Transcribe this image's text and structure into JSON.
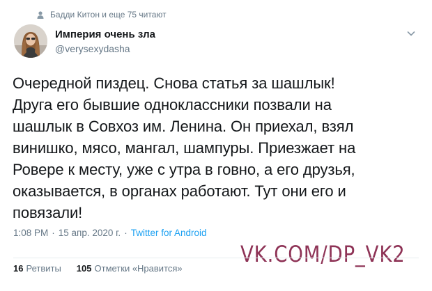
{
  "context": {
    "icon": "person-icon",
    "text": "Бадди Китон и еще 75 читают"
  },
  "author": {
    "avatar": "avatar",
    "display_name": "Империя очень зла",
    "handle": "@verysexydasha"
  },
  "menu": {
    "icon": "chevron-down-icon"
  },
  "tweet": {
    "lines": [
      "Очередной пиздец. Снова статья за шашлык!",
      "Друга его бывшие одноклассники позвали на",
      "шашлык в Совхоз им. Ленина. Он приехал, взял",
      "винишко, мясо, мангал, шампуры. Приезжает на",
      "Ровере к месту, уже с утра в говно, а его друзья,",
      "оказывается, в органах работают. Тут они его и",
      "повязали!"
    ]
  },
  "meta": {
    "time": "1:08 PM",
    "separator": "·",
    "date": "15 апр. 2020 г.",
    "source": "Twitter for Android"
  },
  "watermark": "VK.COM/DP_VK2",
  "stats": {
    "retweets_count": "16",
    "retweets_label": "Ретвиты",
    "likes_count": "105",
    "likes_label": "Отметки «Нравится»"
  },
  "colors": {
    "text": "#14171a",
    "secondary": "#657786",
    "link": "#1da1f2",
    "watermark": "#8e3356",
    "divider": "#e6ecf0"
  }
}
